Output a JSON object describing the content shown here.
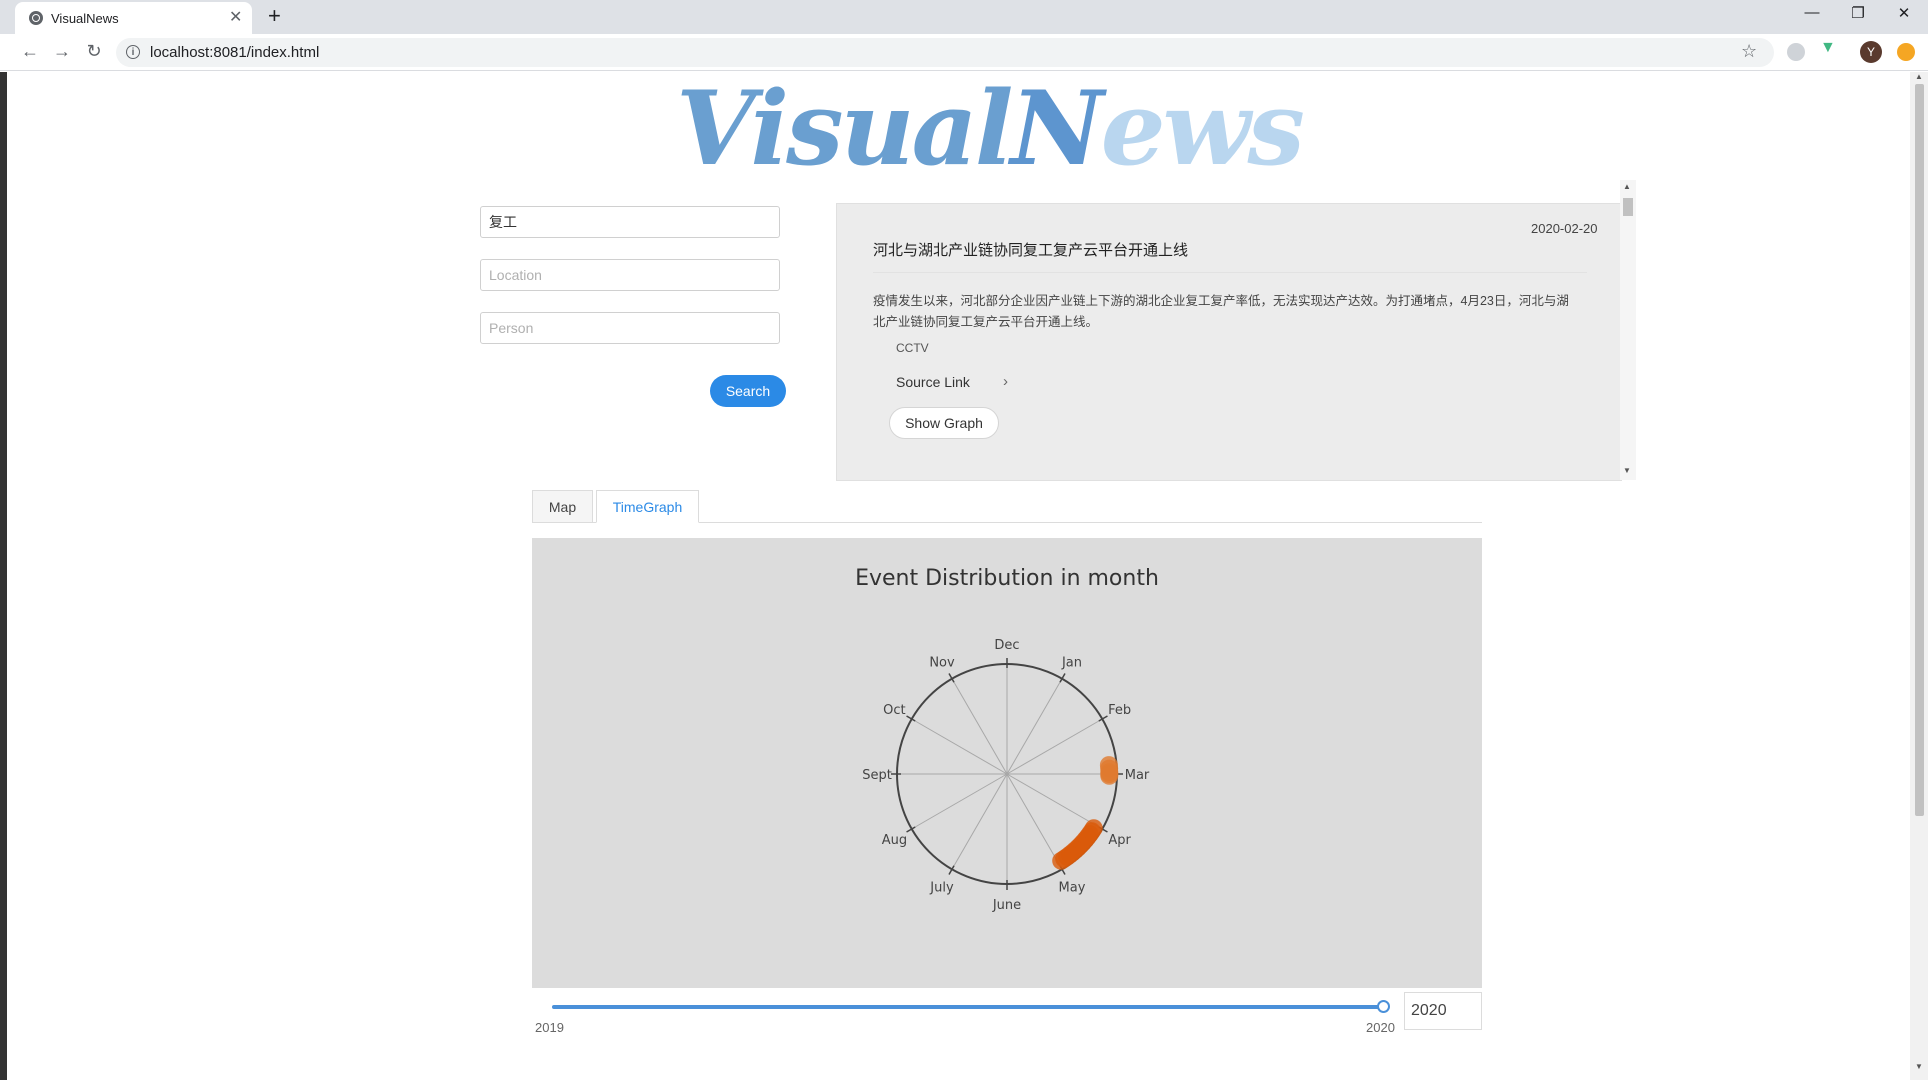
{
  "browser": {
    "tab_title": "VisualNews",
    "url": "localhost:8081/index.html",
    "profile_initial": "Y"
  },
  "logo": {
    "part1": "Visual",
    "part2": "N",
    "part3": "ews"
  },
  "search": {
    "keyword_value": "复工",
    "location_placeholder": "Location",
    "person_placeholder": "Person",
    "button_label": "Search"
  },
  "news": {
    "date": "2020-02-20",
    "title": "河北与湖北产业链协同复工复产云平台开通上线",
    "body": "疫情发生以来，河北部分企业因产业链上下游的湖北企业复工复产率低，无法实现达产达效。为打通堵点，4月23日，河北与湖北产业链协同复工复产云平台开通上线。",
    "source": "CCTV",
    "link_label": "Source Link",
    "graph_button": "Show Graph"
  },
  "tabs": [
    "Map",
    "TimeGraph"
  ],
  "active_tab": "TimeGraph",
  "chart_data": {
    "type": "polar_scatter",
    "title": "Event Distribution in month",
    "months": [
      "Dec",
      "Jan",
      "Feb",
      "Mar",
      "Apr",
      "May",
      "June",
      "July",
      "Aug",
      "Sept",
      "Oct",
      "Nov"
    ],
    "series": [
      {
        "month": "Mar",
        "day_offsets": [
          -5,
          -3,
          -1,
          0,
          1
        ],
        "radius": 0.93,
        "color": "#e07a30"
      },
      {
        "month": "Apr",
        "day_offsets": [
          2,
          4,
          6,
          8,
          10,
          12,
          14,
          16,
          18,
          20,
          22,
          24,
          26,
          28
        ],
        "radius": 0.93,
        "color": "#d95a0a"
      }
    ]
  },
  "year_slider": {
    "min_label": "2019",
    "max_label": "2020",
    "value": "2020"
  },
  "colors": {
    "accent": "#2b8ae6",
    "chart_bg": "#dcdcdc",
    "marker": "#d95a0a"
  }
}
